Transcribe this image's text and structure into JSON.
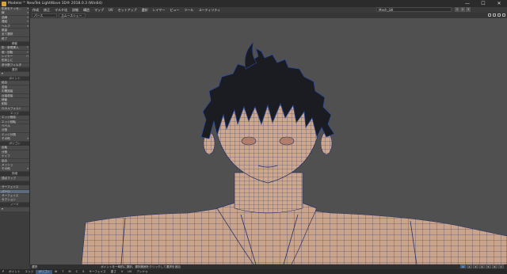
{
  "window": {
    "title": "Modeler™ NewTek LightWave 3D® 2018.0.3 (Win64)",
    "controls": [
      "—",
      "☐",
      "✕"
    ]
  },
  "menubar": {
    "items": [
      "作成",
      "修正",
      "マルチ化",
      "詳細",
      "構造",
      "マップ",
      "UV",
      "セットアップ",
      "選択",
      "レイヤー",
      "ビュー",
      "ツール",
      "ユーティリティ"
    ]
  },
  "layer_select": {
    "value": "Mesh_LW"
  },
  "layer_numbers": [
    "1",
    "2",
    "3"
  ],
  "view_header": {
    "view_type": "パース",
    "shading": "スムースシェード"
  },
  "sidebar": {
    "top_items": [
      {
        "label": "形状をテッセ…",
        "key": "▾"
      },
      {
        "label": "線",
        "key": "▾"
      },
      {
        "label": "曲線",
        "key": "▾"
      },
      {
        "label": "連結",
        "key": "▾"
      },
      {
        "label": "ヘルプ",
        "key": "▾"
      },
      {
        "label": "数量",
        "key": ""
      },
      {
        "label": "全て選択",
        "key": ""
      },
      {
        "label": "終了",
        "key": ""
      }
    ],
    "sections": [
      {
        "header": "移動",
        "items": [
          {
            "label": "形・新規挿入",
            "key": "T"
          },
          {
            "label": "面・回転",
            "key": "Y"
          },
          {
            "label": "レイヤー",
            "key": "H"
          },
          {
            "label": "形状上に",
            "key": ""
          },
          {
            "label": "多分割フィルタ",
            "key": ""
          }
        ]
      },
      {
        "header": "選択",
        "items": [
          {
            "label": "▾",
            "key": ""
          }
        ]
      },
      {
        "header": "ポイント",
        "items": [
          {
            "label": "結合",
            "key": ""
          },
          {
            "label": "溶接",
            "key": ""
          },
          {
            "label": "中間溶接",
            "key": ""
          },
          {
            "label": "近接溶接",
            "key": ""
          },
          {
            "label": "移動",
            "key": ""
          },
          {
            "label": "削除",
            "key": ""
          },
          {
            "label": "ロカルフォルト",
            "key": ""
          }
        ]
      },
      {
        "header": "エッジ",
        "items": [
          {
            "label": "エッジ削除",
            "key": ""
          },
          {
            "label": "エッジ回転",
            "key": ""
          },
          {
            "label": "ベベル",
            "key": ""
          },
          {
            "label": "分割",
            "key": ""
          },
          {
            "label": "エッジ分割",
            "key": ""
          },
          {
            "label": "その他",
            "key": "▾"
          }
        ]
      },
      {
        "header": "ポリゴン",
        "items": [
          {
            "label": "反転",
            "key": ""
          },
          {
            "label": "分割",
            "key": ""
          },
          {
            "label": "ナイフ",
            "key": ""
          },
          {
            "label": "結合",
            "key": ""
          },
          {
            "label": "メッシュ",
            "key": ""
          },
          {
            "label": "その他",
            "key": "▾"
          }
        ]
      },
      {
        "header": "詳細",
        "items": [
          {
            "label": "頂点マップ",
            "key": ""
          }
        ]
      },
      {
        "header": "",
        "items": [
          {
            "label": "サーフェイス",
            "key": ""
          },
          {
            "label": "パーツ",
            "key": ""
          },
          {
            "label": "サーフェイス",
            "key": ""
          },
          {
            "label": "セクション",
            "key": ""
          }
        ]
      },
      {
        "header": "ノード",
        "items": [
          {
            "label": "▾",
            "key": ""
          }
        ]
      }
    ]
  },
  "statusbar": {
    "left": "選択",
    "message": "ポイントを一時的に選択。選択範囲をクリックして選択を追加"
  },
  "bottombar": {
    "items": [
      "P",
      "ポイント",
      "エッジ",
      "ポリゴン",
      "W",
      "T",
      "M",
      "C",
      "S",
      "サーフェイス",
      "重さ",
      "V",
      "UV",
      "アンドゥ"
    ],
    "selected_index": 3
  },
  "selection_buttons": [
    "1",
    "2",
    "3",
    "4",
    "5",
    "6",
    "7"
  ],
  "colors": {
    "viewport_bg": "#505050",
    "skin": "#c9a48a",
    "wire": "#1e2f6a",
    "hair": "#1b1c22",
    "accent": "#3b6aa8"
  }
}
